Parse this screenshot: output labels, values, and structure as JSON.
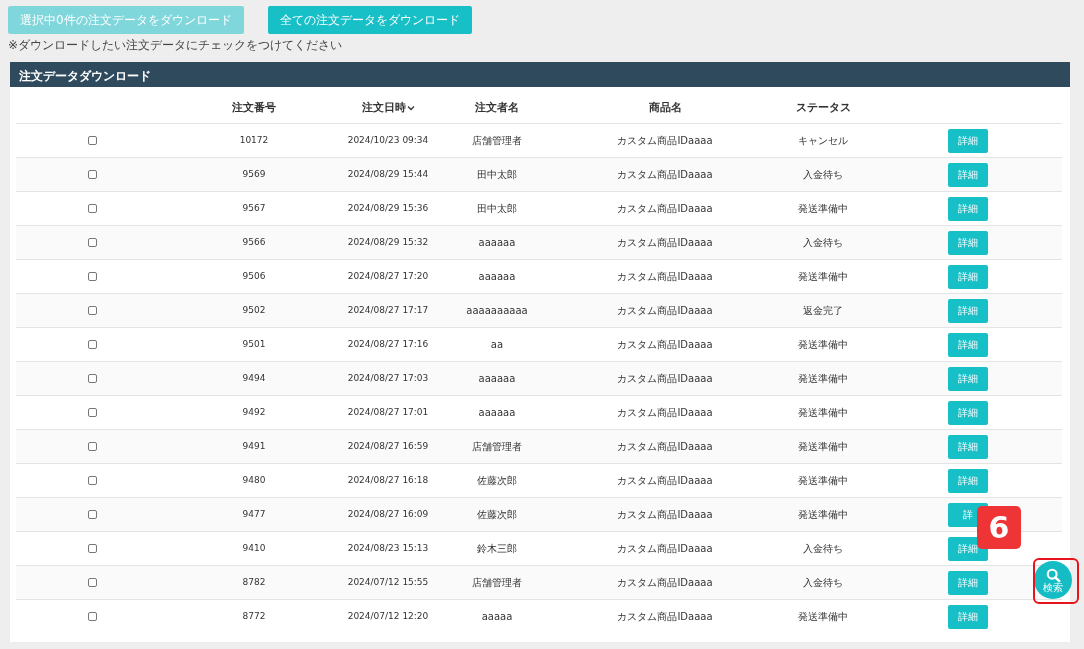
{
  "top_buttons": [
    {
      "label": "選択中0件の注文データをダウンロード",
      "disabled": true
    },
    {
      "label": "全ての注文データをダウンロード",
      "disabled": false
    }
  ],
  "note": "※ダウンロードしたい注文データにチェックをつけてください",
  "panel": {
    "title": "注文データダウンロード",
    "columns": [
      {
        "label": "注文番号",
        "sorted": false
      },
      {
        "label": "注文日時",
        "sorted": true
      },
      {
        "label": "注文者名",
        "sorted": false
      },
      {
        "label": "商品名",
        "sorted": false
      },
      {
        "label": "ステータス",
        "sorted": false
      }
    ],
    "rows": [
      {
        "checked": false,
        "number": "10172",
        "date": "2024/10/23 09:34",
        "customer": "店舗管理者",
        "product": "カスタム商品IDaaaa",
        "status": "キャンセル",
        "action": "詳細"
      },
      {
        "checked": false,
        "number": "9569",
        "date": "2024/08/29 15:44",
        "customer": "田中太郎",
        "product": "カスタム商品IDaaaa",
        "status": "入金待ち",
        "action": "詳細"
      },
      {
        "checked": false,
        "number": "9567",
        "date": "2024/08/29 15:36",
        "customer": "田中太郎",
        "product": "カスタム商品IDaaaa",
        "status": "発送準備中",
        "action": "詳細"
      },
      {
        "checked": false,
        "number": "9566",
        "date": "2024/08/29 15:32",
        "customer": "aaaaaa",
        "product": "カスタム商品IDaaaa",
        "status": "入金待ち",
        "action": "詳細"
      },
      {
        "checked": false,
        "number": "9506",
        "date": "2024/08/27 17:20",
        "customer": "aaaaaa",
        "product": "カスタム商品IDaaaa",
        "status": "発送準備中",
        "action": "詳細"
      },
      {
        "checked": false,
        "number": "9502",
        "date": "2024/08/27 17:17",
        "customer": "aaaaaaaaaa",
        "product": "カスタム商品IDaaaa",
        "status": "返金完了",
        "action": "詳細"
      },
      {
        "checked": false,
        "number": "9501",
        "date": "2024/08/27 17:16",
        "customer": "aa",
        "product": "カスタム商品IDaaaa",
        "status": "発送準備中",
        "action": "詳細"
      },
      {
        "checked": false,
        "number": "9494",
        "date": "2024/08/27 17:03",
        "customer": "aaaaaa",
        "product": "カスタム商品IDaaaa",
        "status": "発送準備中",
        "action": "詳細"
      },
      {
        "checked": false,
        "number": "9492",
        "date": "2024/08/27 17:01",
        "customer": "aaaaaa",
        "product": "カスタム商品IDaaaa",
        "status": "発送準備中",
        "action": "詳細"
      },
      {
        "checked": false,
        "number": "9491",
        "date": "2024/08/27 16:59",
        "customer": "店舗管理者",
        "product": "カスタム商品IDaaaa",
        "status": "発送準備中",
        "action": "詳細"
      },
      {
        "checked": false,
        "number": "9480",
        "date": "2024/08/27 16:18",
        "customer": "佐藤次郎",
        "product": "カスタム商品IDaaaa",
        "status": "発送準備中",
        "action": "詳細"
      },
      {
        "checked": false,
        "number": "9477",
        "date": "2024/08/27 16:09",
        "customer": "佐藤次郎",
        "product": "カスタム商品IDaaaa",
        "status": "発送準備中",
        "action": "詳"
      },
      {
        "checked": false,
        "number": "9410",
        "date": "2024/08/23 15:13",
        "customer": "鈴木三郎",
        "product": "カスタム商品IDaaaa",
        "status": "入金待ち",
        "action": "詳細"
      },
      {
        "checked": false,
        "number": "8782",
        "date": "2024/07/12 15:55",
        "customer": "店舗管理者",
        "product": "カスタム商品IDaaaa",
        "status": "入金待ち",
        "action": "詳細"
      },
      {
        "checked": false,
        "number": "8772",
        "date": "2024/07/12 12:20",
        "customer": "aaaaa",
        "product": "カスタム商品IDaaaa",
        "status": "発送準備中",
        "action": "詳細"
      }
    ]
  },
  "search_button": {
    "label": "検索"
  },
  "annotation": {
    "label": "6"
  }
}
